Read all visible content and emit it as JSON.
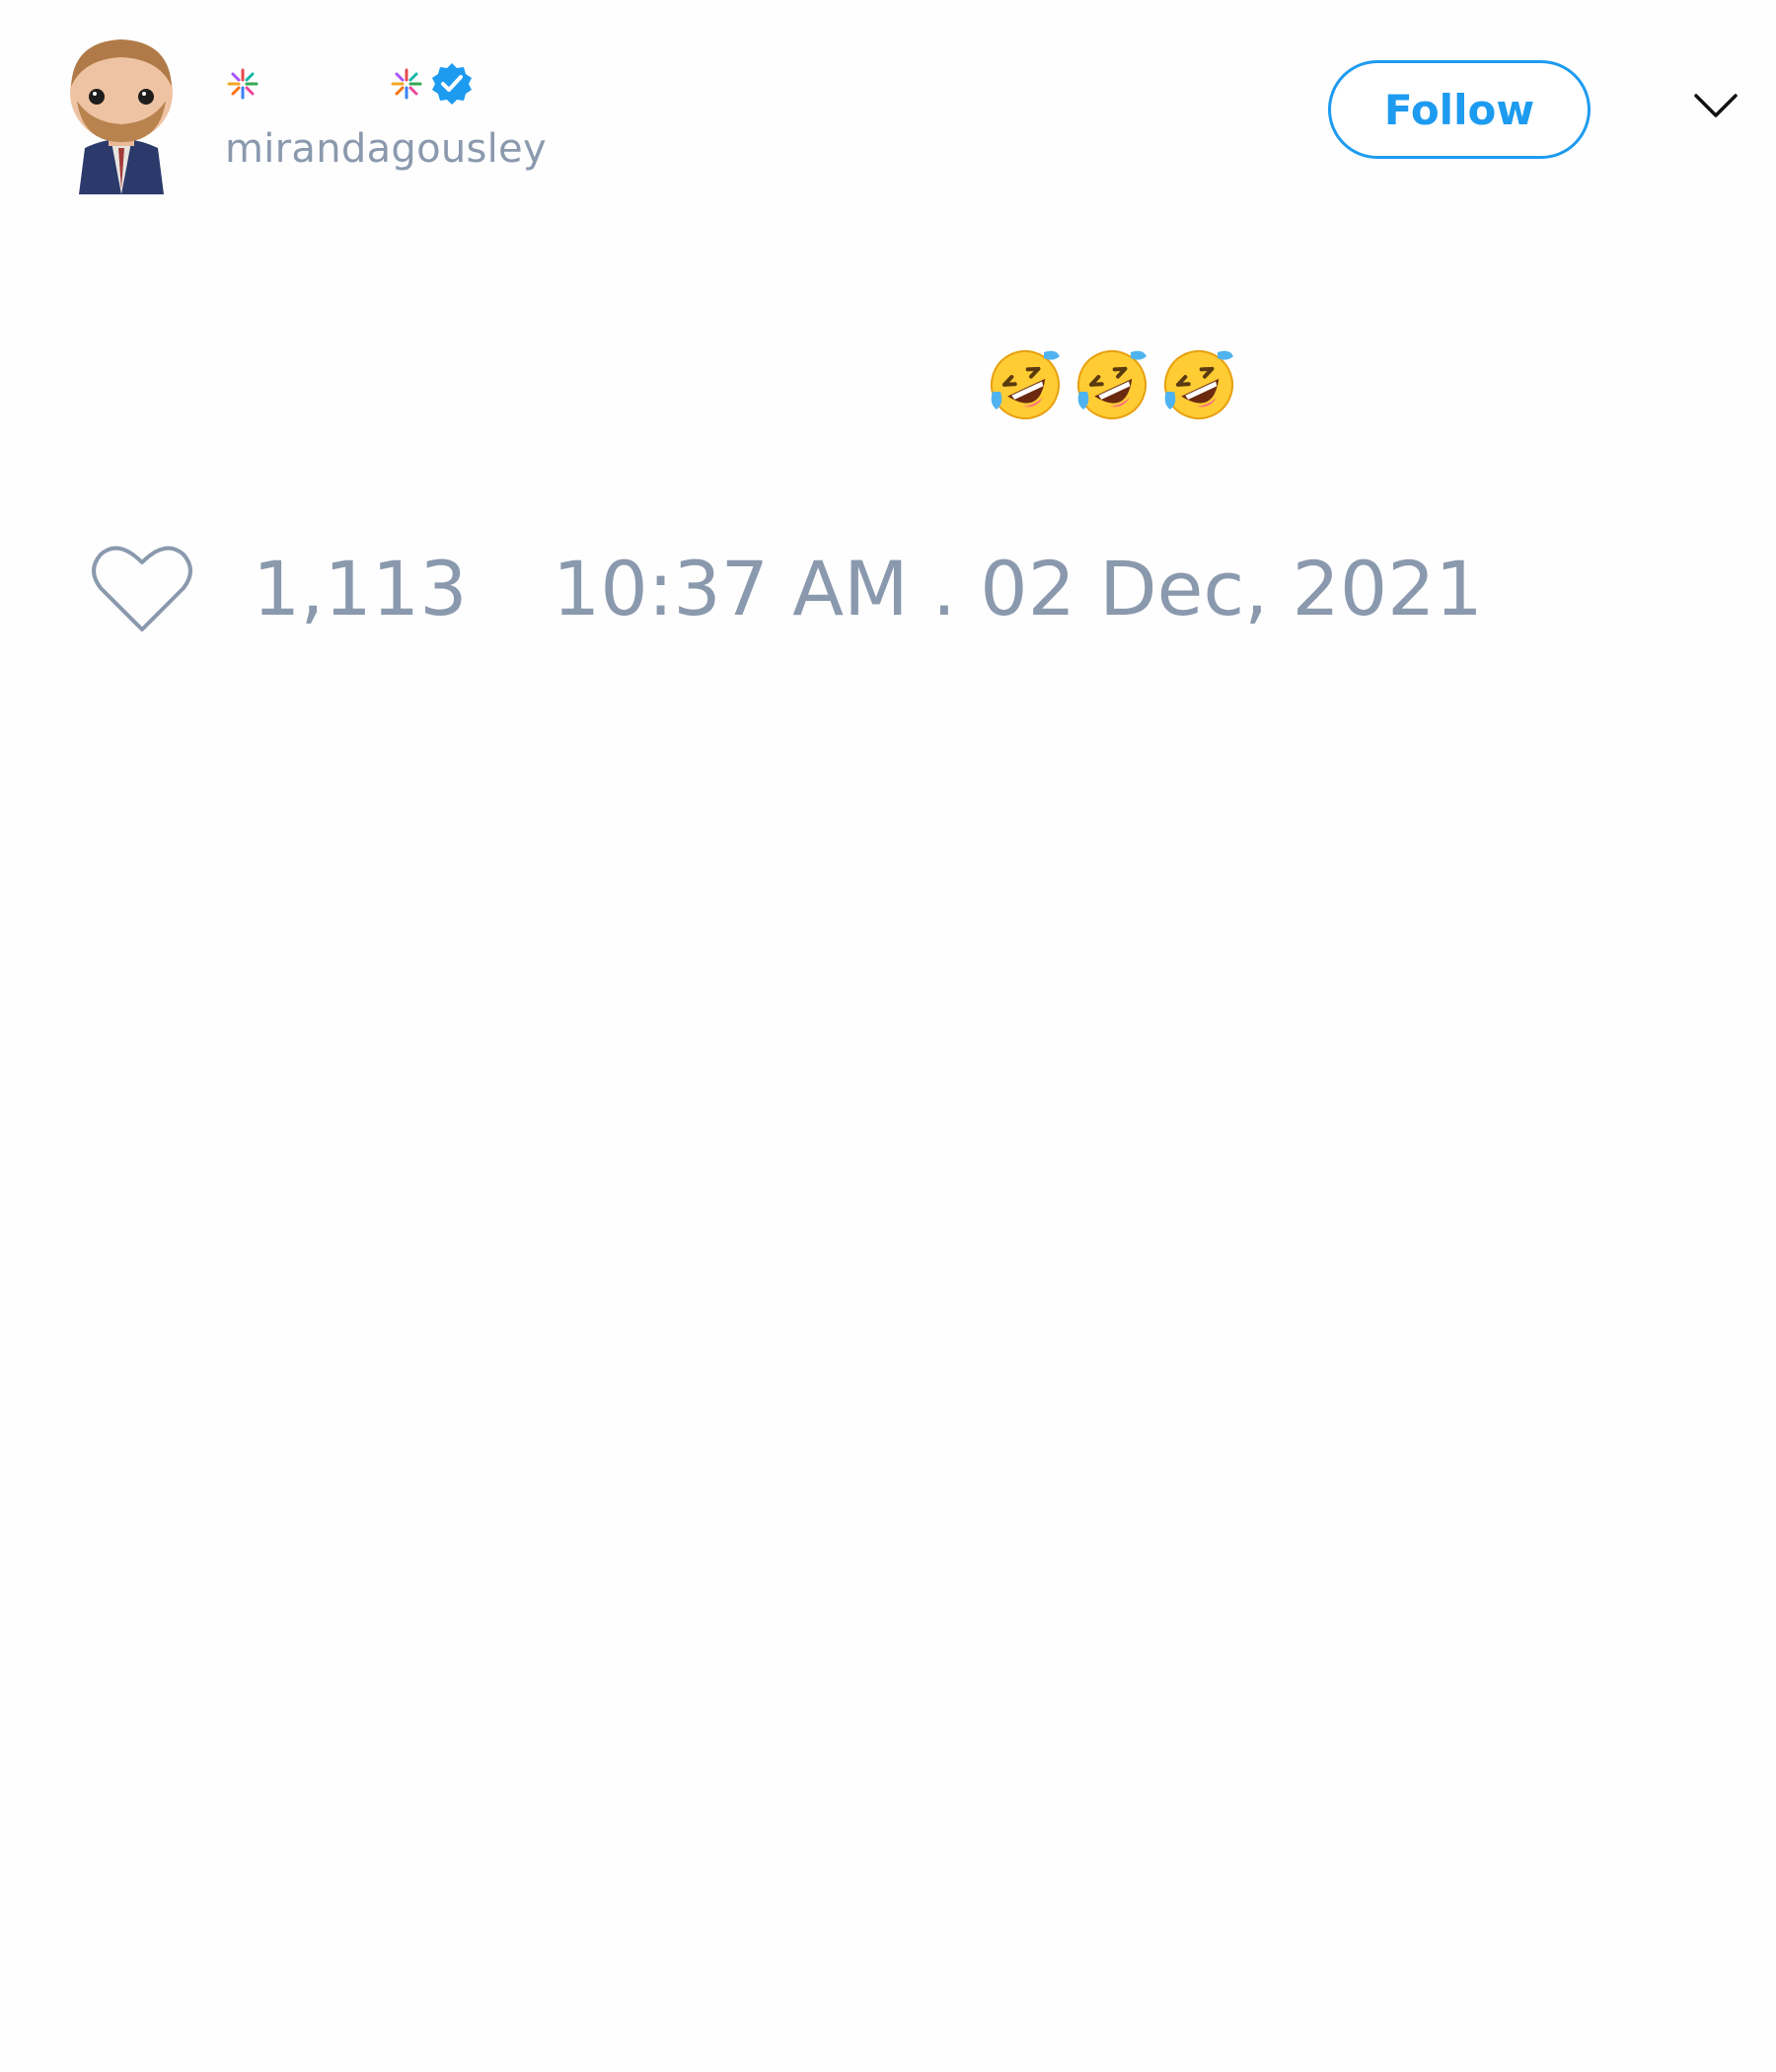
{
  "header": {
    "display_name_icons": [
      "sparkle-icon",
      "sparkle-icon"
    ],
    "verified": true,
    "handle": "mirandagousley",
    "follow_label": "Follow",
    "menu_icon": "chevron-down-icon",
    "accent_color": "#1d9bf0"
  },
  "tweet": {
    "text": "🤣🤣🤣",
    "emojis": [
      "rolling-on-floor-laughing",
      "rolling-on-floor-laughing",
      "rolling-on-floor-laughing"
    ]
  },
  "footer": {
    "like_icon": "heart-icon",
    "like_count": "1,113",
    "timestamp": "10:37 AM . 02 Dec, 2021",
    "muted_color": "#8a99ad"
  }
}
